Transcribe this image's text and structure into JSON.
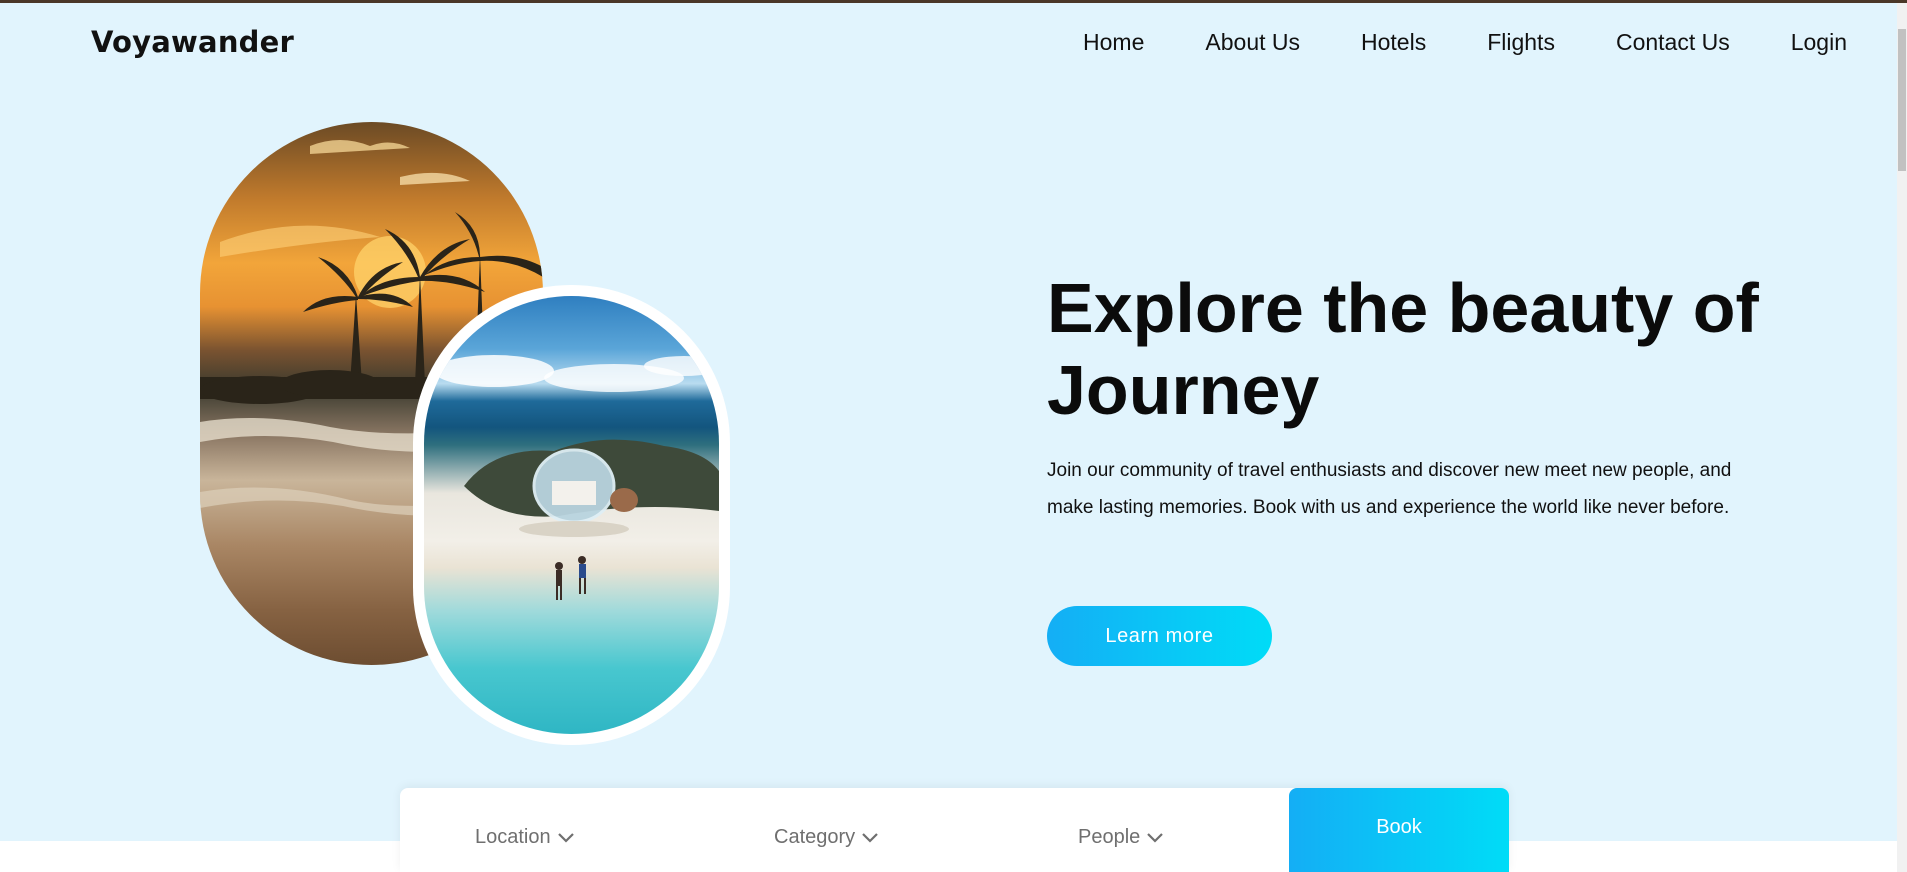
{
  "brand": {
    "name": "Voyawander"
  },
  "nav": {
    "items": [
      {
        "label": "Home"
      },
      {
        "label": "About Us"
      },
      {
        "label": "Hotels"
      },
      {
        "label": "Flights"
      },
      {
        "label": "Contact Us"
      },
      {
        "label": "Login"
      }
    ]
  },
  "hero": {
    "title_line1": "Explore the beauty of",
    "title_line2": "Journey",
    "description": "Join our community of travel enthusiasts and discover new meet new people, and make lasting memories. Book with us and experience the world like never before.",
    "cta_label": "Learn more",
    "images": [
      {
        "icon": "sunset-beach-image"
      },
      {
        "icon": "bubble-tent-beach-image"
      }
    ]
  },
  "booking": {
    "location_label": "Location",
    "category_label": "Category",
    "people_label": "People",
    "book_label": "Book"
  },
  "colors": {
    "hero_background": "#e1f4fd",
    "accent_start": "#14aef5",
    "accent_end": "#00dcf7"
  }
}
